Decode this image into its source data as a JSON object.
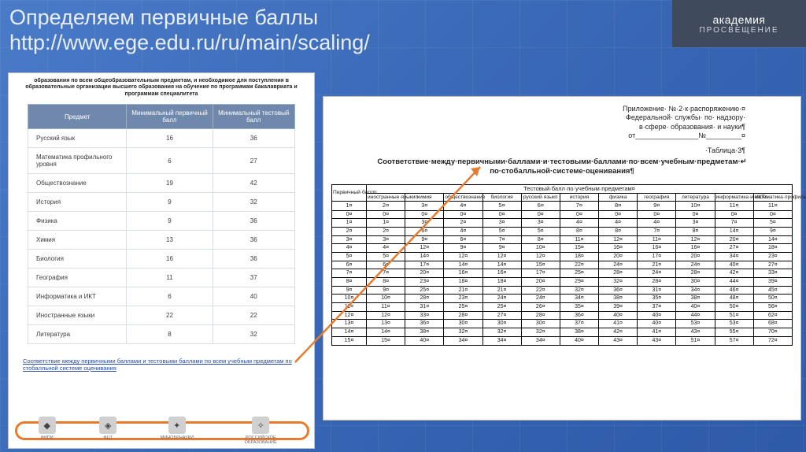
{
  "slide": {
    "title": "Определяем первичные баллы",
    "url": "http://www.ege.edu.ru/ru/main/scaling/"
  },
  "brand": {
    "line1": "академия",
    "line2": "ПРОСВЕЩЕНИЕ"
  },
  "leftPanel": {
    "header": "образования по всем общеобразовательным предметам, и необходимое для поступления в образовательные организации высшего образования на обучение по программам бакалавриата и программам специалитета",
    "cols": [
      "Предмет",
      "Минимальный первичный балл",
      "Минимальный тестовый балл"
    ],
    "rows": [
      {
        "name": "Русский язык",
        "prim": "16",
        "test": "36"
      },
      {
        "name": "Математика профильного уровня",
        "prim": "6",
        "test": "27"
      },
      {
        "name": "Обществознание",
        "prim": "19",
        "test": "42"
      },
      {
        "name": "История",
        "prim": "9",
        "test": "32"
      },
      {
        "name": "Физика",
        "prim": "9",
        "test": "36"
      },
      {
        "name": "Химия",
        "prim": "13",
        "test": "36"
      },
      {
        "name": "Биология",
        "prim": "16",
        "test": "36"
      },
      {
        "name": "География",
        "prim": "11",
        "test": "37"
      },
      {
        "name": "Информатика и ИКТ",
        "prim": "6",
        "test": "40"
      },
      {
        "name": "Иностранные языки",
        "prim": "22",
        "test": "22"
      },
      {
        "name": "Литература",
        "prim": "8",
        "test": "32"
      }
    ],
    "linkText": "Соответствие между первичными баллами и тестовыми баллами по всем учебным предметам по стобалльной системе оценивания",
    "logos": [
      "ФИПИ",
      "ФЦТ",
      "МИНОБРНАУКИ",
      "РОССИЙСКОЕ ОБРАЗОВАНИЕ"
    ]
  },
  "rightPanel": {
    "appendix": [
      "Приложение· №·2·к·распоряжению·¤",
      "Федеральной· службы· по· надзору·",
      "в·сфере· образования· и науки¶",
      "от________________№_________¤"
    ],
    "tableLabel": "·Таблица·3¶",
    "title": "Соответствие·между·первичными·баллами·и·тестовыми·баллами·по·всем·учебным·предметам·↵ по·стобалльной·системе·оценивания¶",
    "primaryHead": "Первичный·балл¤",
    "groupHead": "Тестовый·балл·по·учебным·предметам¤",
    "subjects": [
      "иностранные·языки¤",
      "химия",
      "обществознание",
      "биология",
      "русский·язык¤",
      "история",
      "физика",
      "география",
      "литература",
      "информатика·и·ИКТ¤",
      "математика·профильный·уровень¤"
    ],
    "numHeader": [
      "1¤",
      "2¤",
      "3¤",
      "4¤",
      "5¤",
      "6¤",
      "7¤",
      "8¤",
      "9¤",
      "10¤",
      "11¤",
      "11¤"
    ],
    "dataRows": [
      [
        "0¤",
        "0¤",
        "0¤",
        "0¤",
        "0¤",
        "0¤",
        "0¤",
        "0¤",
        "0¤",
        "0¤",
        "0¤",
        "0¤"
      ],
      [
        "1¤",
        "1¤",
        "3¤",
        "2¤",
        "3¤",
        "3¤",
        "4¤",
        "4¤",
        "4¤",
        "3¤",
        "7¤",
        "5¤"
      ],
      [
        "2¤",
        "2¤",
        "6¤",
        "4¤",
        "5¤",
        "5¤",
        "8¤",
        "8¤",
        "7¤",
        "8¤",
        "14¤",
        "9¤"
      ],
      [
        "3¤",
        "3¤",
        "9¤",
        "6¤",
        "7¤",
        "8¤",
        "11¤",
        "12¤",
        "11¤",
        "12¤",
        "20¤",
        "14¤"
      ],
      [
        "4¤",
        "4¤",
        "12¤",
        "9¤",
        "9¤",
        "10¤",
        "15¤",
        "16¤",
        "16¤",
        "16¤",
        "27¤",
        "18¤"
      ],
      [
        "5¤",
        "5¤",
        "14¤",
        "12¤",
        "12¤",
        "12¤",
        "18¤",
        "20¤",
        "17¤",
        "20¤",
        "34¤",
        "23¤"
      ],
      [
        "6¤",
        "6¤",
        "17¤",
        "14¤",
        "14¤",
        "15¤",
        "22¤",
        "24¤",
        "21¤",
        "24¤",
        "40¤",
        "27¤"
      ],
      [
        "7¤",
        "7¤",
        "20¤",
        "16¤",
        "16¤",
        "17¤",
        "25¤",
        "28¤",
        "24¤",
        "28¤",
        "42¤",
        "33¤"
      ],
      [
        "8¤",
        "8¤",
        "23¤",
        "18¤",
        "18¤",
        "20¤",
        "29¤",
        "32¤",
        "28¤",
        "30¤",
        "44¤",
        "39¤"
      ],
      [
        "9¤",
        "9¤",
        "25¤",
        "21¤",
        "21¤",
        "22¤",
        "32¤",
        "36¤",
        "31¤",
        "34¤",
        "46¤",
        "45¤"
      ],
      [
        "10¤",
        "10¤",
        "28¤",
        "23¤",
        "24¤",
        "24¤",
        "34¤",
        "38¤",
        "35¤",
        "38¤",
        "48¤",
        "50¤"
      ],
      [
        "11¤",
        "11¤",
        "31¤",
        "25¤",
        "25¤",
        "26¤",
        "35¤",
        "39¤",
        "37¤",
        "40¤",
        "50¤",
        "56¤"
      ],
      [
        "12¤",
        "12¤",
        "33¤",
        "28¤",
        "27¤",
        "28¤",
        "36¤",
        "40¤",
        "40¤",
        "44¤",
        "51¤",
        "62¤"
      ],
      [
        "13¤",
        "13¤",
        "36¤",
        "30¤",
        "30¤",
        "30¤",
        "37¤",
        "41¤",
        "40¤",
        "53¤",
        "53¤",
        "68¤"
      ],
      [
        "14¤",
        "14¤",
        "38¤",
        "32¤",
        "32¤",
        "32¤",
        "38¤",
        "42¤",
        "41¤",
        "43¤",
        "55¤",
        "70¤"
      ],
      [
        "15¤",
        "15¤",
        "40¤",
        "34¤",
        "34¤",
        "34¤",
        "40¤",
        "43¤",
        "43¤",
        "51¤",
        "57¤",
        "72¤"
      ]
    ]
  },
  "colors": {
    "accent": "#e77b2f",
    "tableHeadBg": "#6f88ab"
  }
}
